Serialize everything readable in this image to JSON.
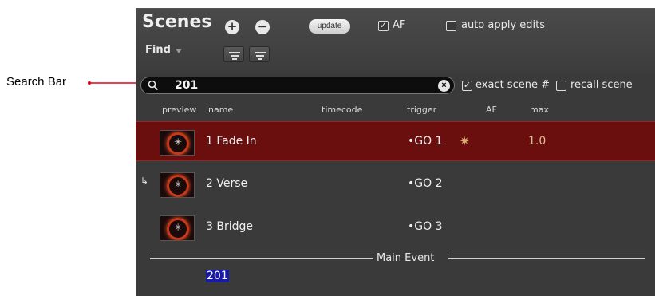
{
  "annotation": {
    "label": "Search Bar"
  },
  "toolbar": {
    "title": "Scenes",
    "add_icon": "plus-circle-icon",
    "remove_icon": "minus-circle-icon",
    "update_label": "update",
    "af_label": "AF",
    "af_checked": true,
    "auto_apply_label": "auto apply edits",
    "auto_apply_checked": false,
    "find_label": "Find"
  },
  "search": {
    "value": "201",
    "exact_label": "exact scene #",
    "exact_checked": true,
    "recall_label": "recall scene",
    "recall_checked": false
  },
  "columns": [
    "preview",
    "name",
    "timecode",
    "trigger",
    "AF",
    "max"
  ],
  "scenes": [
    {
      "name": "1 Fade In",
      "trigger": "•GO 1",
      "af_icon": "gear-icon",
      "max": "1.0",
      "selected": true
    },
    {
      "name": "2 Verse",
      "trigger": "•GO 2",
      "linked": true
    },
    {
      "name": "3 Bridge",
      "trigger": "•GO 3"
    }
  ],
  "divider_label": "Main Event",
  "result_text": "201",
  "colors": {
    "selected_row": "#6a0e0e",
    "highlight": "#1a1aa8",
    "callout_red": "#e0001a"
  }
}
